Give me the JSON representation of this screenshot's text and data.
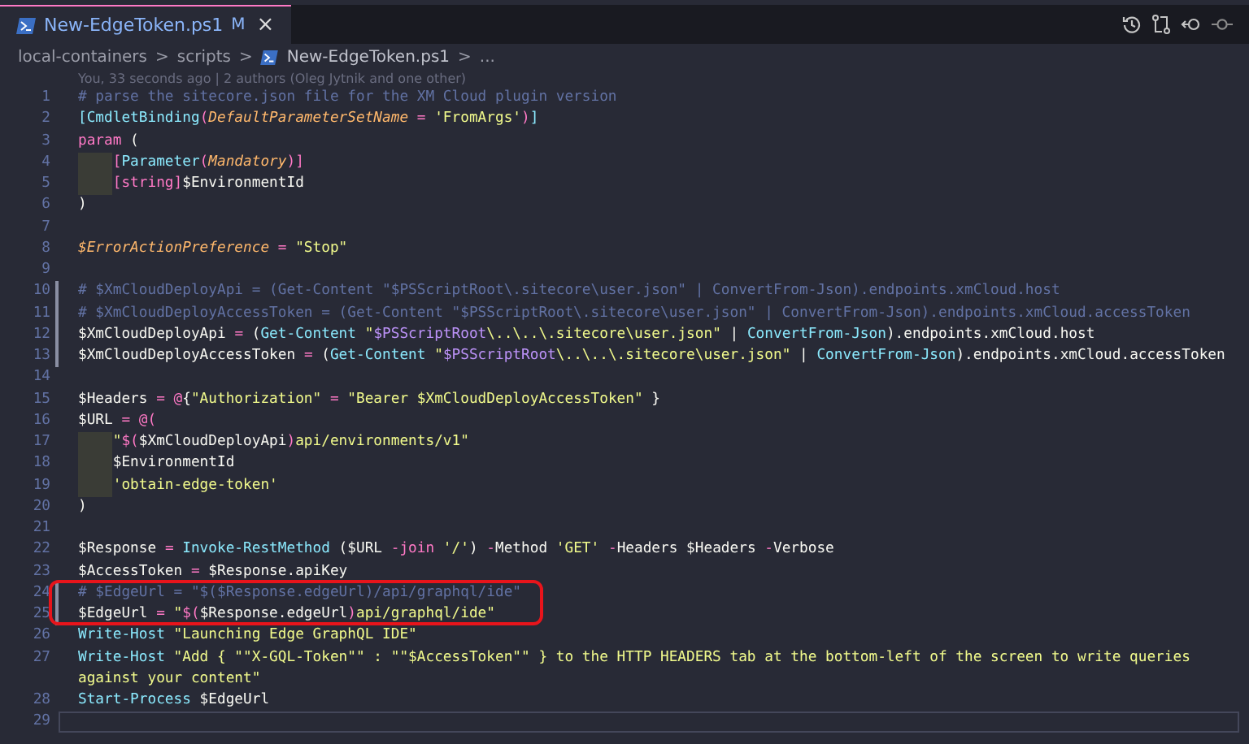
{
  "tab": {
    "title": "New-EdgeToken.ps1",
    "status": "M",
    "close": "×",
    "selected": true
  },
  "breadcrumbs": [
    {
      "label": "local-containers",
      "file": false
    },
    {
      "label": "scripts",
      "file": false
    },
    {
      "label": "New-EdgeToken.ps1",
      "file": true
    },
    {
      "label": "...",
      "file": false
    }
  ],
  "breadcrumb_separator": ">",
  "blame": "You, 33 seconds ago | 2 authors (Oleg Jytnik and one other)",
  "lines": [
    {
      "number": "1",
      "changed": false,
      "indented": false,
      "current": false,
      "segments": [
        {
          "kind": "comment",
          "text": "# parse the sitecore.json file for the XM Cloud plugin version"
        }
      ]
    },
    {
      "number": "2",
      "changed": false,
      "indented": false,
      "current": false,
      "segments": [
        {
          "kind": "command",
          "text": "[CmdletBinding"
        },
        {
          "kind": "operator",
          "text": "("
        },
        {
          "kind": "param",
          "text": "DefaultParameterSetName"
        },
        {
          "kind": "operator",
          "text": " = "
        },
        {
          "kind": "string",
          "text": "'FromArgs'"
        },
        {
          "kind": "operator",
          "text": ")"
        },
        {
          "kind": "command",
          "text": "]"
        }
      ]
    },
    {
      "number": "3",
      "changed": false,
      "indented": false,
      "current": false,
      "segments": [
        {
          "kind": "operator",
          "text": "param"
        },
        {
          "kind": "plain",
          "text": " ("
        }
      ]
    },
    {
      "number": "4",
      "changed": false,
      "indented": true,
      "current": false,
      "segments": [
        {
          "kind": "operator",
          "text": "["
        },
        {
          "kind": "command",
          "text": "Parameter"
        },
        {
          "kind": "operator",
          "text": "("
        },
        {
          "kind": "param",
          "text": "Mandatory"
        },
        {
          "kind": "operator",
          "text": ")]"
        }
      ]
    },
    {
      "number": "5",
      "changed": false,
      "indented": true,
      "current": false,
      "segments": [
        {
          "kind": "operator",
          "text": "[string]"
        },
        {
          "kind": "plain",
          "text": "$EnvironmentId"
        }
      ]
    },
    {
      "number": "6",
      "changed": false,
      "indented": false,
      "current": false,
      "segments": [
        {
          "kind": "plain",
          "text": ")"
        }
      ]
    },
    {
      "number": "7",
      "changed": false
    },
    {
      "number": "8",
      "changed": false,
      "indented": false,
      "current": false,
      "segments": [
        {
          "kind": "param",
          "text": "$ErrorActionPreference"
        },
        {
          "kind": "operator",
          "text": " = "
        },
        {
          "kind": "string",
          "text": "\"Stop\""
        }
      ]
    },
    {
      "number": "9",
      "changed": false
    },
    {
      "number": "10",
      "changed": true,
      "indented": false,
      "current": false,
      "segments": [
        {
          "kind": "comment",
          "text": "# $XmCloudDeployApi = (Get-Content \"$PSScriptRoot\\.sitecore\\user.json\" | ConvertFrom-Json).endpoints.xmCloud.host"
        }
      ]
    },
    {
      "number": "11",
      "changed": true,
      "indented": false,
      "current": false,
      "segments": [
        {
          "kind": "comment",
          "text": "# $XmCloudDeployAccessToken = (Get-Content \"$PSScriptRoot\\.sitecore\\user.json\" | ConvertFrom-Json).endpoints.xmCloud.accessToken"
        }
      ]
    },
    {
      "number": "12",
      "changed": true,
      "indented": false,
      "current": false,
      "segments": [
        {
          "kind": "plain",
          "text": "$XmCloudDeployApi "
        },
        {
          "kind": "operator",
          "text": "="
        },
        {
          "kind": "plain",
          "text": " ("
        },
        {
          "kind": "command",
          "text": "Get-Content"
        },
        {
          "kind": "string",
          "text": " \""
        },
        {
          "kind": "interp",
          "text": "$PSScriptRoot"
        },
        {
          "kind": "string",
          "text": "\\..\\..\\.sitecore\\user.json\""
        },
        {
          "kind": "plain",
          "text": " | "
        },
        {
          "kind": "command",
          "text": "ConvertFrom-Json"
        },
        {
          "kind": "plain",
          "text": ").endpoints.xmCloud.host"
        }
      ]
    },
    {
      "number": "13",
      "changed": true,
      "indented": false,
      "current": false,
      "segments": [
        {
          "kind": "plain",
          "text": "$XmCloudDeployAccessToken "
        },
        {
          "kind": "operator",
          "text": "="
        },
        {
          "kind": "plain",
          "text": " ("
        },
        {
          "kind": "command",
          "text": "Get-Content"
        },
        {
          "kind": "string",
          "text": " \""
        },
        {
          "kind": "interp",
          "text": "$PSScriptRoot"
        },
        {
          "kind": "string",
          "text": "\\..\\..\\.sitecore\\user.json\""
        },
        {
          "kind": "plain",
          "text": " | "
        },
        {
          "kind": "command",
          "text": "ConvertFrom-Json"
        },
        {
          "kind": "plain",
          "text": ").endpoints.xmCloud.accessToken"
        }
      ]
    },
    {
      "number": "14",
      "changed": false
    },
    {
      "number": "15",
      "changed": false,
      "indented": false,
      "current": false,
      "segments": [
        {
          "kind": "plain",
          "text": "$Headers "
        },
        {
          "kind": "operator",
          "text": "= @"
        },
        {
          "kind": "plain",
          "text": "{"
        },
        {
          "kind": "string",
          "text": "\"Authorization\""
        },
        {
          "kind": "operator",
          "text": " = "
        },
        {
          "kind": "string",
          "text": "\"Bearer $XmCloudDeployAccessToken\""
        },
        {
          "kind": "plain",
          "text": " }"
        }
      ]
    },
    {
      "number": "16",
      "changed": false,
      "indented": false,
      "current": false,
      "segments": [
        {
          "kind": "plain",
          "text": "$URL "
        },
        {
          "kind": "operator",
          "text": "= @("
        }
      ]
    },
    {
      "number": "17",
      "changed": false,
      "indented": true,
      "current": false,
      "segments": [
        {
          "kind": "string",
          "text": "\""
        },
        {
          "kind": "operator",
          "text": "$("
        },
        {
          "kind": "plain",
          "text": "$XmCloudDeployApi"
        },
        {
          "kind": "operator",
          "text": ")"
        },
        {
          "kind": "string",
          "text": "api/environments/v1\""
        }
      ]
    },
    {
      "number": "18",
      "changed": false,
      "indented": true,
      "current": false,
      "segments": [
        {
          "kind": "plain",
          "text": "$EnvironmentId"
        }
      ]
    },
    {
      "number": "19",
      "changed": false,
      "indented": true,
      "current": false,
      "segments": [
        {
          "kind": "string",
          "text": "'obtain-edge-token'"
        }
      ]
    },
    {
      "number": "20",
      "changed": false,
      "indented": false,
      "current": false,
      "segments": [
        {
          "kind": "plain",
          "text": ")"
        }
      ]
    },
    {
      "number": "21",
      "changed": false
    },
    {
      "number": "22",
      "changed": false,
      "indented": false,
      "current": false,
      "segments": [
        {
          "kind": "plain",
          "text": "$Response "
        },
        {
          "kind": "operator",
          "text": "="
        },
        {
          "kind": "command",
          "text": " Invoke-RestMethod"
        },
        {
          "kind": "plain",
          "text": " ($URL "
        },
        {
          "kind": "operator",
          "text": "-join"
        },
        {
          "kind": "string",
          "text": " '/'"
        },
        {
          "kind": "plain",
          "text": ") "
        },
        {
          "kind": "operator",
          "text": "-"
        },
        {
          "kind": "plain",
          "text": "Method "
        },
        {
          "kind": "string",
          "text": "'GET'"
        },
        {
          "kind": "operator",
          "text": " -"
        },
        {
          "kind": "plain",
          "text": "Headers $Headers "
        },
        {
          "kind": "operator",
          "text": "-"
        },
        {
          "kind": "plain",
          "text": "Verbose"
        }
      ]
    },
    {
      "number": "23",
      "changed": false,
      "indented": false,
      "current": false,
      "segments": [
        {
          "kind": "plain",
          "text": "$AccessToken "
        },
        {
          "kind": "operator",
          "text": "="
        },
        {
          "kind": "plain",
          "text": " $Response.apiKey"
        }
      ]
    },
    {
      "number": "24",
      "changed": true,
      "indented": false,
      "current": false,
      "segments": [
        {
          "kind": "comment",
          "text": "# $EdgeUrl = \"$($Response.edgeUrl)/api/graphql/ide\""
        }
      ]
    },
    {
      "number": "25",
      "changed": true,
      "indented": false,
      "current": false,
      "segments": [
        {
          "kind": "plain",
          "text": "$EdgeUrl "
        },
        {
          "kind": "operator",
          "text": "="
        },
        {
          "kind": "string",
          "text": " \""
        },
        {
          "kind": "operator",
          "text": "$("
        },
        {
          "kind": "plain",
          "text": "$Response.edgeUrl"
        },
        {
          "kind": "operator",
          "text": ")"
        },
        {
          "kind": "string",
          "text": "api/graphql/ide\""
        }
      ]
    },
    {
      "number": "26",
      "changed": false,
      "indented": false,
      "current": false,
      "segments": [
        {
          "kind": "command",
          "text": "Write-Host"
        },
        {
          "kind": "string",
          "text": " \"Launching Edge GraphQL IDE\""
        }
      ]
    },
    {
      "number": "27",
      "changed": false,
      "indented": false,
      "current": false,
      "segments": [
        {
          "kind": "command",
          "text": "Write-Host"
        },
        {
          "kind": "string",
          "text": " \"Add { \"\"X-GQL-Token\"\" : \"\"$AccessToken\"\" } to the HTTP HEADERS tab at the bottom-left of the screen to write queries against your content\""
        }
      ]
    },
    {
      "number": "28",
      "changed": false,
      "indented": false,
      "current": false,
      "segments": [
        {
          "kind": "command",
          "text": "Start-Process"
        },
        {
          "kind": "plain",
          "text": " $EdgeUrl"
        }
      ]
    },
    {
      "number": "29",
      "changed": false,
      "current": true
    }
  ]
}
